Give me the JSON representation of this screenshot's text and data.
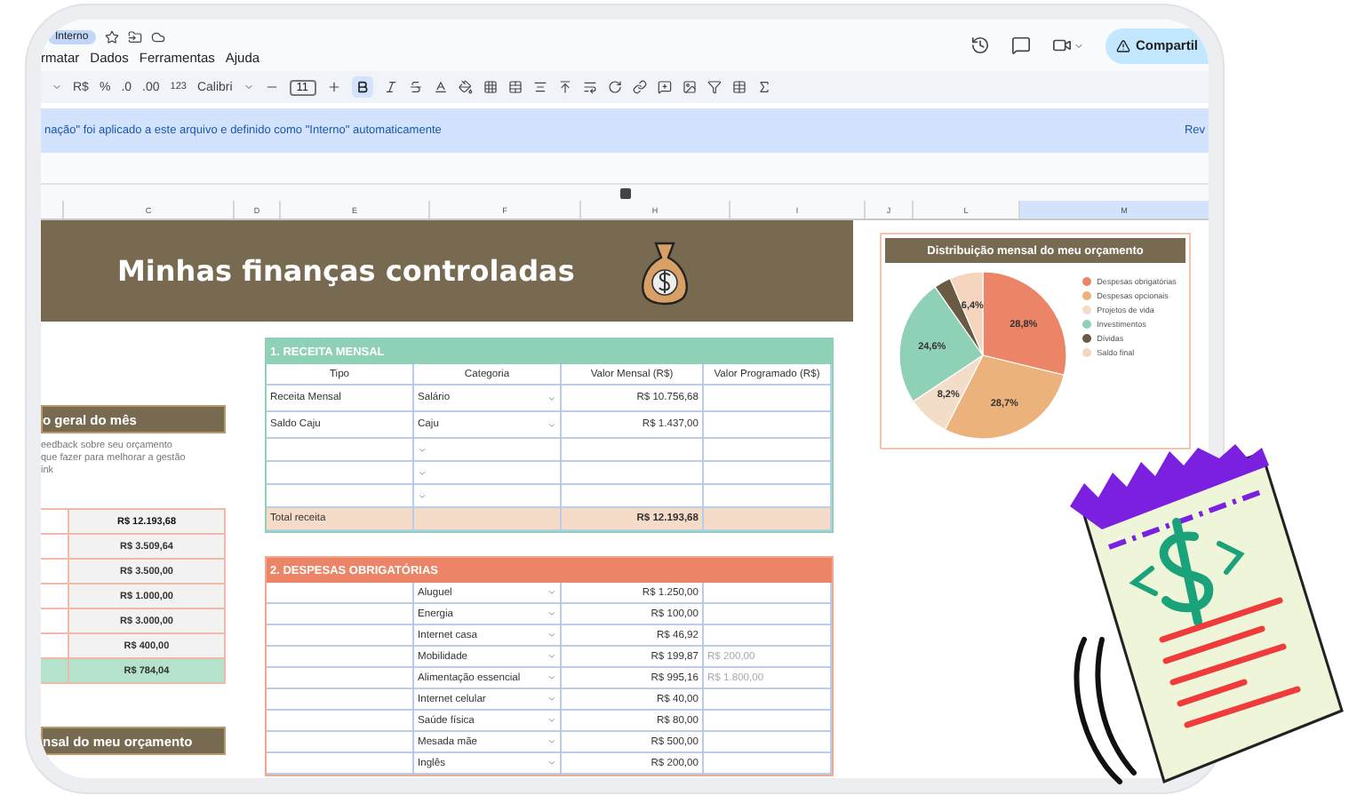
{
  "header": {
    "badge": "Interno",
    "menu": [
      "rmatar",
      "Dados",
      "Ferramentas",
      "Ajuda"
    ],
    "share_button": "Compartil"
  },
  "toolbar": {
    "currency": "R$",
    "percent": "%",
    "decrease_decimals": ".0",
    "increase_decimals": ".00",
    "number_format": "123",
    "font": "Calibri",
    "font_size": "11",
    "bold_on": true
  },
  "banner": {
    "message": "nação\" foi aplicado a este arquivo e definido como \"Interno\" automaticamente",
    "link": "Rev"
  },
  "columns": [
    {
      "label": "C",
      "selected": false
    },
    {
      "label": "D",
      "selected": false
    },
    {
      "label": "E",
      "selected": false
    },
    {
      "label": "F",
      "selected": false
    },
    {
      "label": "H",
      "selected": false
    },
    {
      "label": "I",
      "selected": false
    },
    {
      "label": "J",
      "selected": false
    },
    {
      "label": "L",
      "selected": false
    },
    {
      "label": "M",
      "selected": true
    }
  ],
  "title": "Minhas finanças controladas",
  "summary": {
    "title": "o geral do mês",
    "description": "eedback sobre seu orçamento\n que fazer para melhorar a gestão\nink",
    "rows": [
      {
        "value": "R$ 12.193,68",
        "kind": "total"
      },
      {
        "value": "R$ 3.509,64",
        "kind": "normal"
      },
      {
        "value": "R$ 3.500,00",
        "kind": "normal"
      },
      {
        "value": "R$ 1.000,00",
        "kind": "normal"
      },
      {
        "value": "R$ 3.000,00",
        "kind": "normal"
      },
      {
        "value": "R$ 400,00",
        "kind": "normal"
      },
      {
        "value": "R$ 784,04",
        "kind": "balance"
      }
    ],
    "footer_title": "nsal do meu orçamento"
  },
  "income": {
    "title": "1. RECEITA MENSAL",
    "columns": [
      "Tipo",
      "Categoria",
      "Valor Mensal (R$)",
      "Valor Programado (R$)"
    ],
    "rows": [
      {
        "type": "Receita Mensal",
        "category": "Salário",
        "monthly": "R$ 10.756,68"
      },
      {
        "type": "Saldo Caju",
        "category": "Caju",
        "monthly": "R$ 1.437,00"
      },
      {},
      {},
      {}
    ],
    "total": {
      "label": "Total receita",
      "monthly": "R$ 12.193,68"
    }
  },
  "expenses": {
    "title": "2. DESPESAS OBRIGATÓRIAS",
    "rows": [
      {
        "category": "Aluguel",
        "monthly": "R$ 1.250,00"
      },
      {
        "category": "Energia",
        "monthly": "R$ 100,00"
      },
      {
        "category": "Internet casa",
        "monthly": "R$ 46,92"
      },
      {
        "category": "Mobilidade",
        "monthly": "R$ 199,87",
        "planned": "R$ 200,00"
      },
      {
        "category": "Alimentação essencial",
        "monthly": "R$ 995,16",
        "planned": "R$ 1.800,00"
      },
      {
        "category": "Internet celular",
        "monthly": "R$ 40,00"
      },
      {
        "category": "Saúde física",
        "monthly": "R$ 80,00"
      },
      {
        "category": "Mesada mãe",
        "monthly": "R$ 500,00"
      },
      {
        "category": "Inglês",
        "monthly": "R$ 200,00"
      }
    ]
  },
  "chart": {
    "title": "Distribuição mensal do meu orçamento",
    "chart_data": {
      "type": "pie",
      "categories": [
        "Despesas obrigatórias",
        "Despesas opcionais",
        "Projetos de vida",
        "Investimentos",
        "Dívidas",
        "Saldo final"
      ],
      "series": [
        {
          "values": [
            28.8,
            28.7,
            8.2,
            24.6,
            3.3,
            6.4
          ]
        }
      ],
      "colors": [
        "#ec8468",
        "#ecb27b",
        "#f3dcc8",
        "#8fd1b6",
        "#6b5a43",
        "#f5d5bd"
      ],
      "value_labels": [
        "28,8%",
        "28,7%",
        "8,2%",
        "24,6%",
        null,
        "6,4%"
      ]
    }
  }
}
